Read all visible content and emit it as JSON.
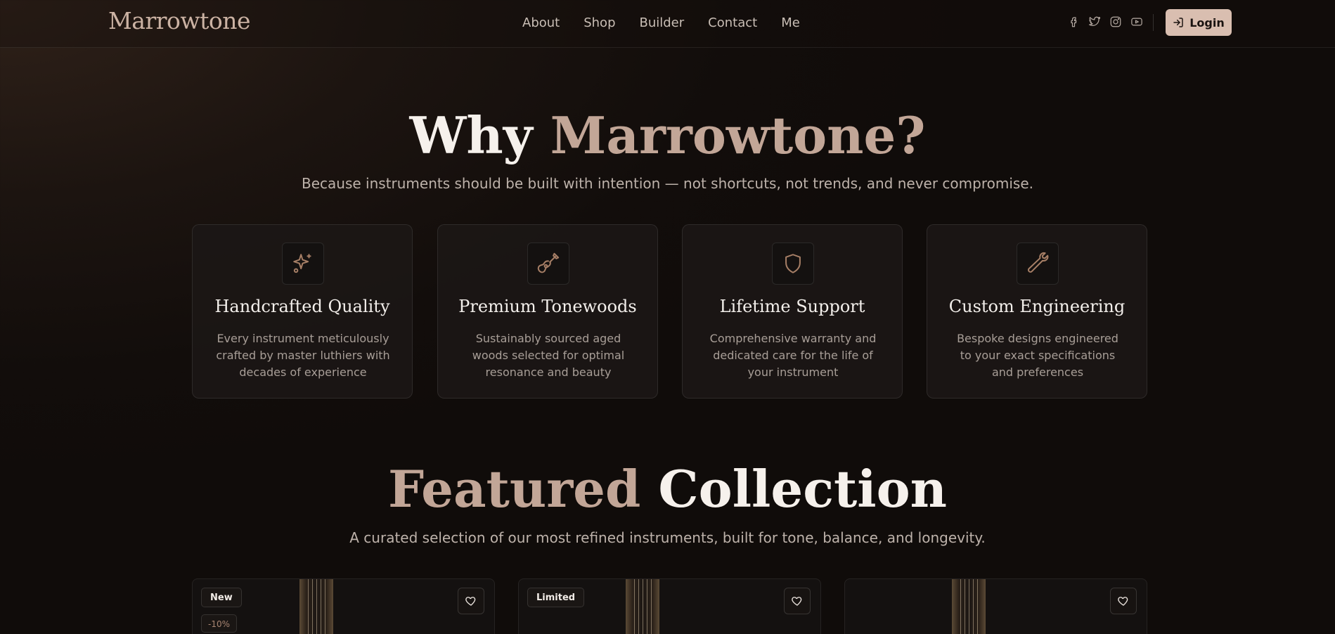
{
  "header": {
    "logo": "Marrowtone",
    "nav": [
      "About",
      "Shop",
      "Builder",
      "Contact",
      "Me"
    ],
    "socials": [
      "facebook-icon",
      "twitter-icon",
      "instagram-icon",
      "youtube-icon"
    ],
    "login_label": "Login"
  },
  "why": {
    "title_plain": "Why ",
    "title_accent": "Marrowtone?",
    "subtitle": "Because instruments should be built with intention — not shortcuts, not trends, and never compromise."
  },
  "features": [
    {
      "icon": "sparkles-icon",
      "title": "Handcrafted Quality",
      "desc": "Every instrument meticulously crafted by master luthiers with decades of experience"
    },
    {
      "icon": "guitar-icon",
      "title": "Premium Tonewoods",
      "desc": "Sustainably sourced aged woods selected for optimal resonance and beauty"
    },
    {
      "icon": "shield-icon",
      "title": "Lifetime Support",
      "desc": "Comprehensive warranty and dedicated care for the life of your instrument"
    },
    {
      "icon": "wrench-icon",
      "title": "Custom Engineering",
      "desc": "Bespoke designs engineered to your exact specifications and preferences"
    }
  ],
  "featured": {
    "title_accent": "Featured",
    "title_plain": " Collection",
    "subtitle": "A curated selection of our most refined instruments, built for tone, balance, and longevity."
  },
  "products": [
    {
      "badge": "New",
      "discount": "-10%"
    },
    {
      "badge": "Limited",
      "discount": ""
    },
    {
      "badge": "",
      "discount": ""
    }
  ],
  "colors": {
    "accent": "#c2a697",
    "button": "#d9beb0",
    "background": "#120d0b"
  }
}
